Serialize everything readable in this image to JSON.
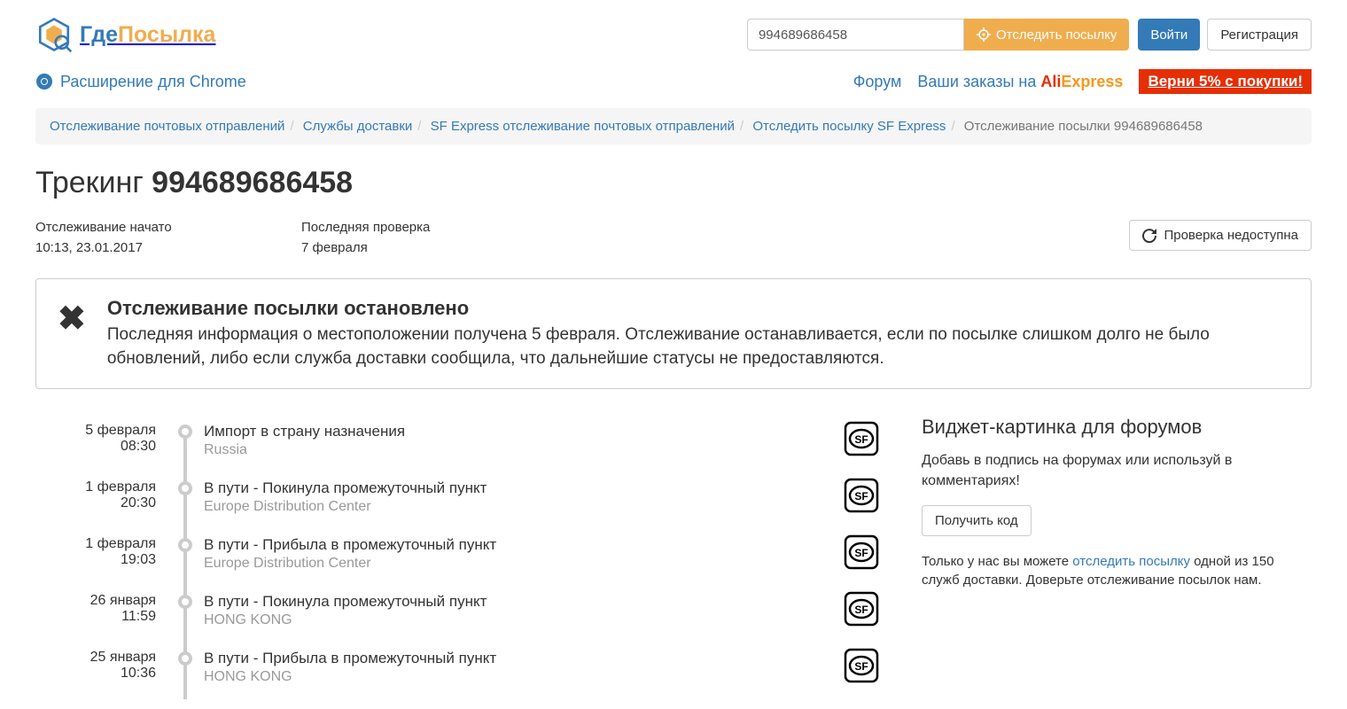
{
  "header": {
    "logo_gde": "Где",
    "logo_posylka": "Посылка",
    "track_value": "994689686458",
    "track_btn": "Отследить посылку",
    "login": "Войти",
    "register": "Регистрация"
  },
  "subnav": {
    "chrome_ext": "Расширение для Chrome",
    "forum": "Форум",
    "orders_prefix": "Ваши заказы на ",
    "ali1": "Ali",
    "ali2": "Express",
    "cashback": "Верни 5% с покупки!"
  },
  "breadcrumb": {
    "b1": "Отслеживание почтовых отправлений",
    "b2": "Службы доставки",
    "b3": "SF Express отслеживание почтовых отправлений",
    "b4": "Отследить посылку SF Express",
    "b5": "Отслеживание посылки 994689686458"
  },
  "title": {
    "prefix": "Трекинг ",
    "number": "994689686458"
  },
  "meta": {
    "started_label": "Отслеживание начато",
    "started_value": "10:13, 23.01.2017",
    "checked_label": "Последняя проверка",
    "checked_value": "7 февраля",
    "refresh_btn": "Проверка недоступна"
  },
  "alert": {
    "title": "Отслеживание посылки остановлено",
    "body": "Последняя информация о местоположении получена 5 февраля. Отслеживание останавливается, если по посылке слишком долго не было обновлений, либо если служба доставки сообщила, что дальнейшие статусы не предоставляются."
  },
  "timeline": [
    {
      "date": "5 февраля",
      "time": "08:30",
      "status": "Импорт в страну назначения",
      "location": "Russia"
    },
    {
      "date": "1 февраля",
      "time": "20:30",
      "status": "В пути - Покинула промежуточный пункт",
      "location": "Europe Distribution Center"
    },
    {
      "date": "1 февраля",
      "time": "19:03",
      "status": "В пути - Прибыла в промежуточный пункт",
      "location": "Europe Distribution Center"
    },
    {
      "date": "26 января",
      "time": "11:59",
      "status": "В пути - Покинула промежуточный пункт",
      "location": "HONG KONG"
    },
    {
      "date": "25 января",
      "time": "10:36",
      "status": "В пути - Прибыла в промежуточный пункт",
      "location": "HONG KONG"
    }
  ],
  "side": {
    "title": "Виджет-картинка для форумов",
    "text": "Добавь в подпись на форумах или используй в комментариях!",
    "get_code": "Получить код",
    "note_prefix": "Только у нас вы можете ",
    "note_link": "отследить посылку",
    "note_suffix": " одной из 150 служб доставки. Доверьте отслеживание посылок нам."
  }
}
